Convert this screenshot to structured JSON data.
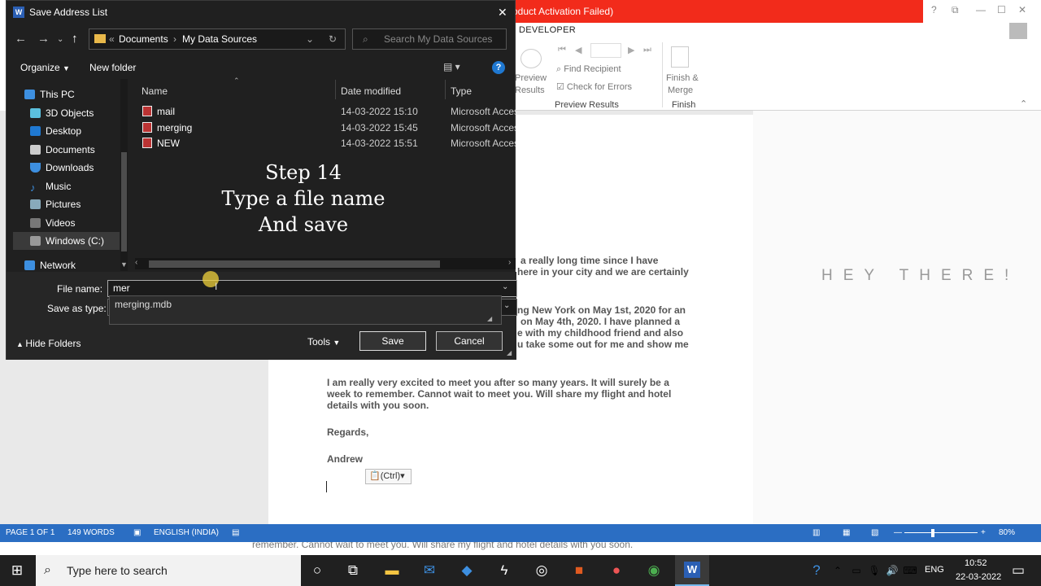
{
  "word": {
    "banner": "oduct Activation Failed)",
    "window_controls": [
      "?",
      "⧉",
      "—",
      "☐",
      "✕"
    ],
    "tab": "DEVELOPER",
    "ribbon": {
      "preview_a": "Preview",
      "preview_b": "Results",
      "find_recipient": "Find Recipient",
      "check_errors": "Check for Errors",
      "group_preview": "Preview Results",
      "finish_a": "Finish &",
      "finish_b": "Merge",
      "group_finish": "Finish"
    },
    "doc": {
      "hey": "HEY THERE!",
      "p1a": "a really long time since I have",
      "p1b": "here in your city and we are certainly",
      "p2a": "ng New York on May 1st, 2020 for an",
      "p2b": "on May 4th, 2020. I have planned a",
      "p2c": "e with my childhood friend and also",
      "p2d": "u take some out for me and show me",
      "p3a": "I am really very excited to meet you after so many years. It will surely be a",
      "p3b": "week to remember. Cannot wait to meet you. Will share my flight and hotel",
      "p3c": "details with you soon.",
      "regards": "Regards,",
      "name": "Andrew",
      "ctrl": "(Ctrl)"
    },
    "status": {
      "page": "PAGE 1 OF 1",
      "words": "149 WORDS",
      "lang": "ENGLISH (INDIA)",
      "zoom": "80%"
    },
    "strip": "remember. Cannot wait to meet you. Will share my flight and hotel details with you soon."
  },
  "dialog": {
    "title": "Save Address List",
    "breadcrumb": [
      "Documents",
      "My Data Sources"
    ],
    "search_placeholder": "Search My Data Sources",
    "organize": "Organize",
    "new_folder": "New folder",
    "nav": [
      "This PC",
      "3D Objects",
      "Desktop",
      "Documents",
      "Downloads",
      "Music",
      "Pictures",
      "Videos",
      "Windows (C:)",
      "Network"
    ],
    "columns": {
      "name": "Name",
      "date": "Date modified",
      "type": "Type"
    },
    "files": [
      {
        "name": "mail",
        "date": "14-03-2022 15:10",
        "type": "Microsoft Acces"
      },
      {
        "name": "merging",
        "date": "14-03-2022 15:45",
        "type": "Microsoft Acces"
      },
      {
        "name": "NEW",
        "date": "14-03-2022 15:51",
        "type": "Microsoft Acces"
      }
    ],
    "overlay": [
      "Step 14",
      "Type a file name",
      "And save"
    ],
    "file_name_label": "File name:",
    "file_name_value": "mer",
    "save_type_label": "Save as type:",
    "suggestion": "merging.mdb",
    "hide_folders": "Hide Folders",
    "tools": "Tools",
    "save": "Save",
    "cancel": "Cancel"
  },
  "taskbar": {
    "search": "Type here to search",
    "lang": "ENG",
    "time": "10:52",
    "date": "22-03-2022"
  },
  "colors": {
    "accent": "#2b6ec3",
    "banner": "#f22b1b",
    "dialog_bg": "#202020"
  }
}
